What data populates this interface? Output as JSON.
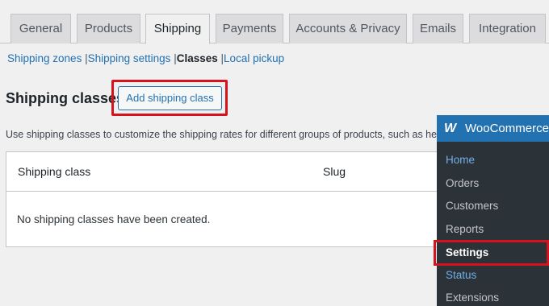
{
  "tabs": [
    {
      "label": "General",
      "active": false
    },
    {
      "label": "Products",
      "active": false
    },
    {
      "label": "Shipping",
      "active": true
    },
    {
      "label": "Payments",
      "active": false
    },
    {
      "label": "Accounts & Privacy",
      "active": false
    },
    {
      "label": "Emails",
      "active": false
    },
    {
      "label": "Integration",
      "active": false
    }
  ],
  "subnav": {
    "zones": "Shipping zones",
    "settings": "Shipping settings",
    "classes": "Classes",
    "pickup": "Local pickup",
    "sep": "|"
  },
  "page": {
    "heading": "Shipping classes",
    "add_button": "Add shipping class",
    "description": "Use shipping classes to customize the shipping rates for different groups of products, such as heavy"
  },
  "table": {
    "col_class": "Shipping class",
    "col_slug": "Slug",
    "empty_message": "No shipping classes have been created."
  },
  "wc_menu": {
    "logo": "W",
    "title": "WooCommerce",
    "items": [
      {
        "label": "Home",
        "state": "current"
      },
      {
        "label": "Orders",
        "state": ""
      },
      {
        "label": "Customers",
        "state": ""
      },
      {
        "label": "Reports",
        "state": ""
      },
      {
        "label": "Settings",
        "state": "bold"
      },
      {
        "label": "Status",
        "state": "current"
      },
      {
        "label": "Extensions",
        "state": ""
      }
    ]
  },
  "colors": {
    "accent": "#2271b1",
    "highlight": "#d6121d",
    "menu_bg": "#2c3338"
  }
}
